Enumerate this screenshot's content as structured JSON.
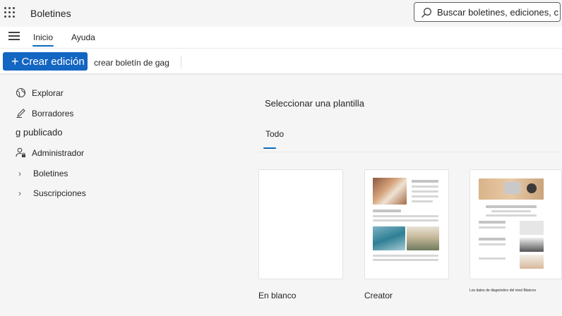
{
  "header": {
    "app_title": "Boletines",
    "search_value": "Buscar boletines, ediciones, c"
  },
  "ribbon": {
    "tabs": [
      "Inicio",
      "Ayuda"
    ]
  },
  "commandbar": {
    "create_label": "Crear edición",
    "extra_text": "crear boletín de gag"
  },
  "sidebar": {
    "explore": "Explorar",
    "drafts": "Borradores",
    "published": "g publicado",
    "admin": "Administrador",
    "newsletters": "Boletines",
    "subscriptions": "Suscripciones"
  },
  "main": {
    "title": "Seleccionar una plantilla",
    "filter_tab": "Todo",
    "templates": [
      {
        "label": "En blanco"
      },
      {
        "label": "Creator"
      },
      {
        "label": "Los datos de diagnóstico del nivel Básicos"
      }
    ]
  },
  "colors": {
    "accent": "#0f6cbd",
    "create_button": "#1366c2"
  }
}
